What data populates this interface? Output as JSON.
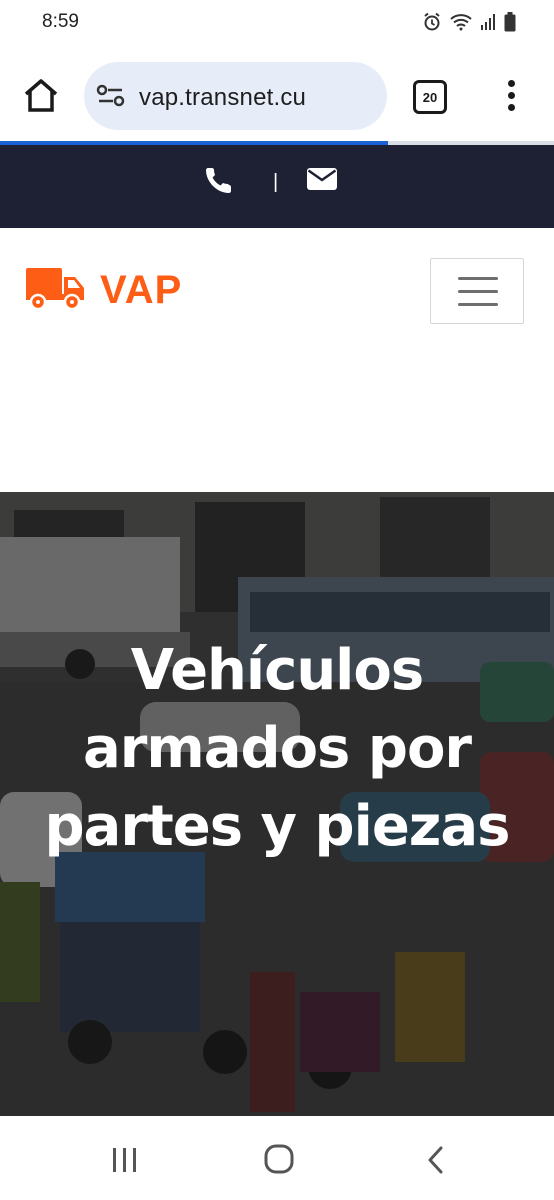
{
  "status_bar": {
    "time": "8:59",
    "icons": [
      "alarm-icon",
      "wifi-icon",
      "signal-icon",
      "battery-icon"
    ]
  },
  "browser": {
    "url": "vap.transnet.cu",
    "tab_count": "20",
    "page_load_progress": 0.7,
    "icons": [
      "home-icon",
      "site-info-icon",
      "more-vert-icon"
    ]
  },
  "topbar": {
    "separator": "|",
    "icons": [
      "phone-icon",
      "envelope-icon"
    ]
  },
  "navbar": {
    "logo_text": "VAP",
    "icons": [
      "truck-icon",
      "hamburger-menu-icon"
    ]
  },
  "hero": {
    "title": "Vehículos armados por partes y piezas"
  },
  "colors": {
    "brand_orange": "#fd5d14",
    "topbar_dark": "#1e2133",
    "url_pill": "#e7edf8",
    "progress_blue": "#1a62d6"
  },
  "system_nav": {
    "icons": [
      "recents-icon",
      "home-circle-icon",
      "back-icon"
    ]
  }
}
